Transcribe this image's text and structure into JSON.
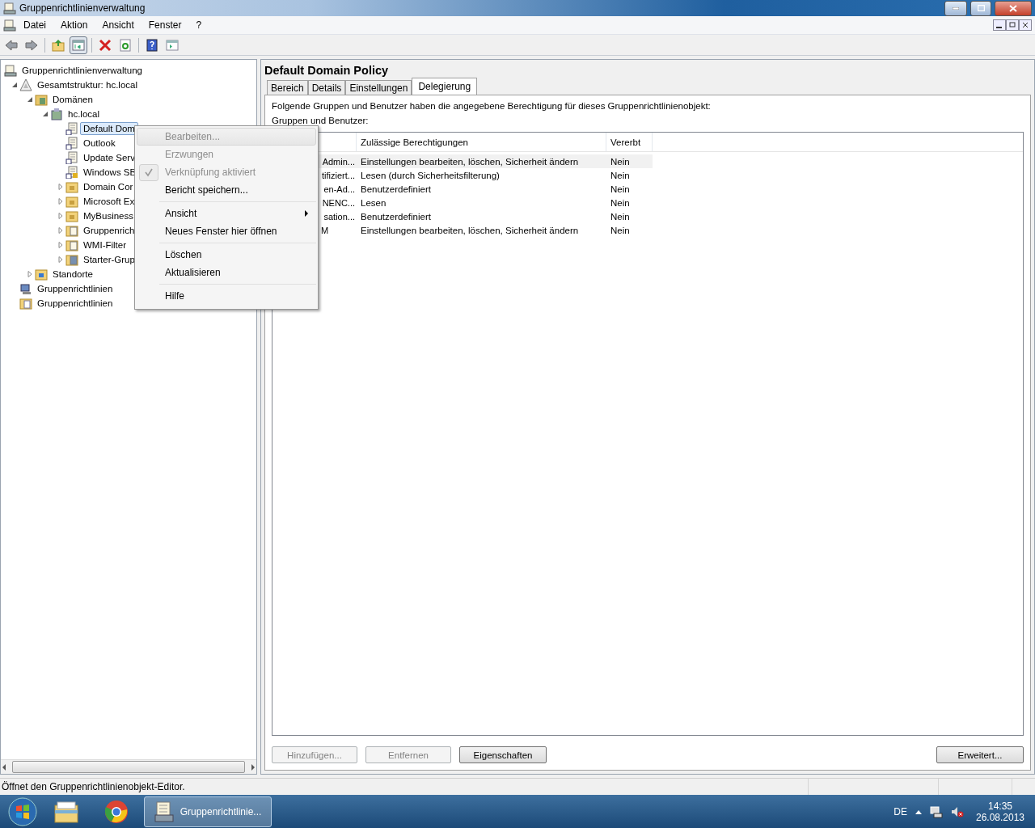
{
  "window": {
    "title": "Gruppenrichtlinienverwaltung"
  },
  "menu_bar": [
    "Datei",
    "Aktion",
    "Ansicht",
    "Fenster",
    "?"
  ],
  "toolbar": [
    {
      "kind": "back"
    },
    {
      "kind": "forward"
    },
    {
      "kind": "sep"
    },
    {
      "kind": "up"
    },
    {
      "kind": "pane",
      "selected": true
    },
    {
      "kind": "sep"
    },
    {
      "kind": "delete"
    },
    {
      "kind": "refresh"
    },
    {
      "kind": "sep"
    },
    {
      "kind": "help"
    },
    {
      "kind": "panel",
      "selected": false
    }
  ],
  "tree": [
    {
      "label": "Gruppenrichtlinienverwaltung",
      "kind": "root",
      "selected": false,
      "children": [
        {
          "label": "Gesamtstruktur: hc.local",
          "kind": "forest",
          "expanded": true,
          "selected": false,
          "children": [
            {
              "label": "Domänen",
              "kind": "domains",
              "expanded": true,
              "selected": false,
              "children": [
                {
                  "label": "hc.local",
                  "kind": "domain",
                  "expanded": true,
                  "selected": false,
                  "children": [
                    {
                      "label": "Default Dom",
                      "kind": "link",
                      "selected": true
                    },
                    {
                      "label": "Outlook",
                      "kind": "link",
                      "selected": false
                    },
                    {
                      "label": "Update Serv",
                      "kind": "link",
                      "selected": false
                    },
                    {
                      "label": "Windows SB",
                      "kind": "locked",
                      "selected": false
                    },
                    {
                      "label": "Domain Cor",
                      "kind": "folder",
                      "expanded": false,
                      "selected": false
                    },
                    {
                      "label": "Microsoft Ex",
                      "kind": "folder",
                      "expanded": false,
                      "selected": false
                    },
                    {
                      "label": "MyBusiness",
                      "kind": "folder",
                      "expanded": false,
                      "selected": false
                    },
                    {
                      "label": "Gruppenrich",
                      "kind": "gpos",
                      "expanded": false,
                      "selected": false
                    },
                    {
                      "label": "WMI-Filter",
                      "kind": "wmi",
                      "expanded": false,
                      "selected": false
                    },
                    {
                      "label": "Starter-Grup",
                      "kind": "starter",
                      "expanded": false,
                      "selected": false
                    }
                  ]
                }
              ]
            },
            {
              "label": "Standorte",
              "kind": "sites",
              "expanded": false,
              "selected": false
            }
          ]
        },
        {
          "label": "Gruppenrichtlinien",
          "kind": "modeling",
          "selected": false
        },
        {
          "label": "Gruppenrichtlinien",
          "kind": "results",
          "selected": false
        }
      ]
    }
  ],
  "context_menu": [
    [
      {
        "label": "Bearbeiten...",
        "disabled": true,
        "checked": false,
        "submenu": false,
        "selected": true
      },
      {
        "label": "Erzwungen",
        "disabled": true,
        "checked": false,
        "submenu": false,
        "selected": false
      },
      {
        "label": "Verknüpfung aktiviert",
        "disabled": true,
        "checked": true,
        "submenu": false,
        "selected": false
      },
      {
        "label": "Bericht speichern...",
        "disabled": false,
        "checked": false,
        "submenu": false,
        "selected": false
      }
    ],
    [
      {
        "label": "Ansicht",
        "disabled": false,
        "checked": false,
        "submenu": true,
        "selected": false
      },
      {
        "label": "Neues Fenster hier öffnen",
        "disabled": false,
        "checked": false,
        "submenu": false,
        "selected": false
      }
    ],
    [
      {
        "label": "Löschen",
        "disabled": false,
        "checked": false,
        "submenu": false,
        "selected": false
      },
      {
        "label": "Aktualisieren",
        "disabled": false,
        "checked": false,
        "submenu": false,
        "selected": false
      }
    ],
    [
      {
        "label": "Hilfe",
        "disabled": false,
        "checked": false,
        "submenu": false,
        "selected": false
      }
    ]
  ],
  "details": {
    "title": "Default Domain Policy",
    "tabs": [
      {
        "label": "Bereich",
        "selected": false
      },
      {
        "label": "Details",
        "selected": false
      },
      {
        "label": "Einstellungen",
        "selected": false
      },
      {
        "label": "Delegierung",
        "selected": true
      }
    ],
    "description": "Folgende Gruppen und Benutzer haben die angegebene Berechtigung für dieses Gruppenrichtlinienobjekt:",
    "list_label": "Gruppen und Benutzer:",
    "table": {
      "columns": [
        "",
        "Zulässige Berechtigungen",
        "Vererbt"
      ],
      "rows": [
        {
          "cells": [
            "Admin...",
            "Einstellungen bearbeiten, löschen, Sicherheit ändern",
            "Nein"
          ],
          "selected": true
        },
        {
          "cells": [
            "tifiziert...",
            "Lesen (durch Sicherheitsfilterung)",
            "Nein"
          ],
          "selected": false
        },
        {
          "cells": [
            "en-Ad...",
            "Benutzerdefiniert",
            "Nein"
          ],
          "selected": false
        },
        {
          "cells": [
            "NENC...",
            "Lesen",
            "Nein"
          ],
          "selected": false
        },
        {
          "cells": [
            "sation...",
            "Benutzerdefiniert",
            "Nein"
          ],
          "selected": false
        },
        {
          "cells": [
            "M",
            "Einstellungen bearbeiten, löschen, Sicherheit ändern",
            "Nein"
          ],
          "selected": false
        }
      ]
    },
    "buttons": [
      {
        "label": "Hinzufügen...",
        "disabled": true
      },
      {
        "label": "Entfernen",
        "disabled": true
      },
      {
        "label": "Eigenschaften",
        "disabled": false
      }
    ],
    "advanced_button": {
      "label": "Erweitert...",
      "disabled": false
    }
  },
  "status_bar": "Öffnet den Gruppenrichtlinienobjekt-Editor.",
  "taskbar": {
    "tasks": [
      {
        "kind": "explorer",
        "selected": false
      },
      {
        "kind": "browser",
        "selected": false
      },
      {
        "kind": "app",
        "label": "Gruppenrichtlinie...",
        "selected": true
      }
    ],
    "language": "DE",
    "time": "14:35",
    "date": "26.08.2013"
  }
}
